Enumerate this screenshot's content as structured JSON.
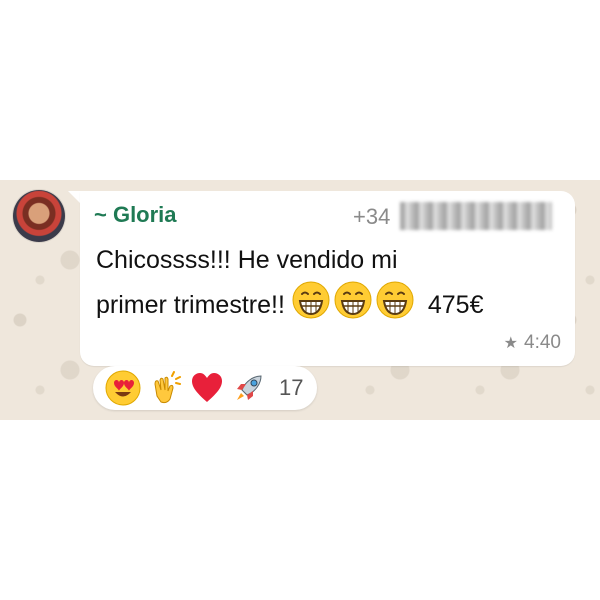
{
  "message": {
    "sender": "~ Gloria",
    "phone_prefix": "+34",
    "text_line1": "Chicossss!!! He vendido mi",
    "text_line2": "primer trimestre!!",
    "price": "475€",
    "time": "4:40",
    "inline_emojis": [
      "grinning-face-with-smiling-eyes",
      "grinning-face-with-smiling-eyes",
      "grinning-face-with-smiling-eyes"
    ]
  },
  "reactions": {
    "icons": [
      "heart-eyes-face",
      "clapping-hands",
      "red-heart",
      "rocket"
    ],
    "count": "17"
  },
  "colors": {
    "sender": "#1f7a54",
    "chat_background": "#efe7dc",
    "bubble": "#ffffff",
    "meta": "#8a8a8a"
  }
}
